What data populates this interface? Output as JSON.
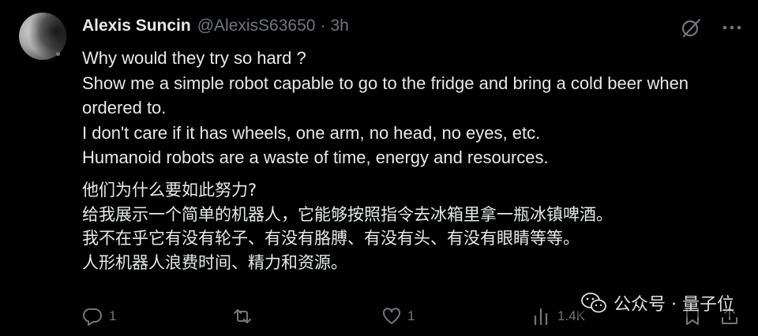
{
  "tweet": {
    "author_name": "Alexis Suncin",
    "handle": "@AlexisS63650",
    "separator": "·",
    "time": "3h",
    "body_en": [
      "Why would they try so hard ?",
      "Show me a simple robot capable to go to the fridge and bring a cold beer when ordered to.",
      "I don't care if it has wheels, one arm, no head, no eyes, etc.",
      "Humanoid robots are a waste of time, energy and resources."
    ],
    "body_zh": [
      "他们为什么要如此努力?",
      "给我展示一个简单的机器人，它能够按照指令去冰箱里拿一瓶冰镇啤酒。",
      "我不在乎它有没有轮子、有没有胳膊、有没有头、有没有眼睛等等。",
      "人形机器人浪费时间、精力和资源。"
    ]
  },
  "actions": {
    "reply_count": "1",
    "retweet_count": "",
    "like_count": "1",
    "views_count": "1.4K"
  },
  "watermark": {
    "label": "公众号 · 量子位"
  },
  "icons": {
    "top": [
      "grok-icon",
      "more-icon"
    ],
    "actions": [
      "reply-icon",
      "retweet-icon",
      "like-icon",
      "views-icon",
      "bookmark-icon",
      "share-icon"
    ]
  },
  "colors": {
    "background": "#000000",
    "text": "#e7e9ea",
    "muted": "#71767b"
  }
}
